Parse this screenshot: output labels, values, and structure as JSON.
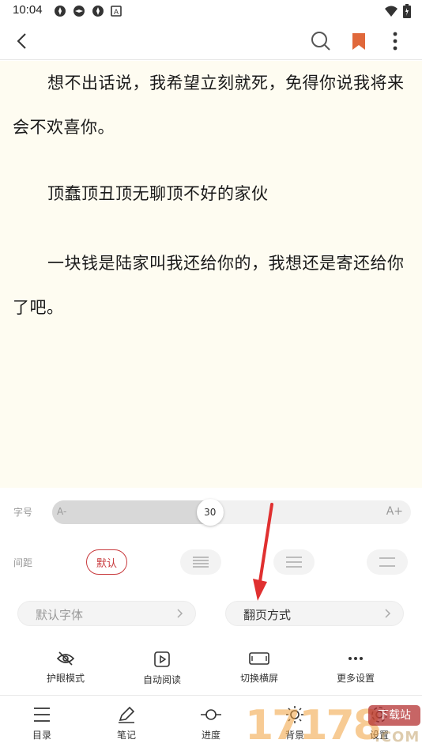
{
  "status_bar": {
    "time": "10:04",
    "left_icons": [
      "app-notification-icon",
      "app-notification-icon",
      "app-notification-icon",
      "a-box-icon"
    ],
    "right_icons": [
      "wifi-icon",
      "battery-icon"
    ]
  },
  "app_bar": {
    "icons": [
      "back-icon",
      "search-icon",
      "bookmark-icon",
      "more-vertical-icon"
    ],
    "bookmark_color": "#e0683b"
  },
  "reader": {
    "background": "#fefcf1",
    "paragraphs": [
      "想不出话说，我希望立刻就死，免得你说我将来会不欢喜你。",
      "顶蠢顶丑顶无聊顶不好的家伙",
      "一块钱是陆家叫我还给你的，我想还是寄还给你了吧。"
    ]
  },
  "settings": {
    "font_size": {
      "label": "字号",
      "small_a": "A-",
      "big_a": "A+",
      "value": "30",
      "level": 0.44
    },
    "spacing": {
      "label": "间距",
      "default_label": "默认",
      "options": [
        "spacing-default",
        "spacing-tight-icon",
        "spacing-medium-icon",
        "spacing-wide-icon"
      ]
    },
    "font_button": {
      "label": "默认字体"
    },
    "page_turn_button": {
      "label": "翻页方式"
    },
    "tools": [
      {
        "label": "护眼模式",
        "icon": "eye-off-icon"
      },
      {
        "label": "自动阅读",
        "icon": "play-box-icon"
      },
      {
        "label": "切换横屏",
        "icon": "landscape-icon"
      },
      {
        "label": "更多设置",
        "icon": "more-horizontal-icon"
      }
    ],
    "accent_color": "#c8393c"
  },
  "bottom_nav": {
    "items": [
      {
        "label": "目录",
        "icon": "list-icon"
      },
      {
        "label": "笔记",
        "icon": "pen-icon"
      },
      {
        "label": "进度",
        "icon": "progress-icon"
      },
      {
        "label": "背景",
        "icon": "brightness-icon"
      },
      {
        "label": "设置",
        "icon": "settings-icon"
      }
    ]
  },
  "watermark": {
    "number": "17178",
    "badge": "下载站",
    "suffix": ".COM"
  },
  "annotation": {
    "color": "#e03030"
  }
}
